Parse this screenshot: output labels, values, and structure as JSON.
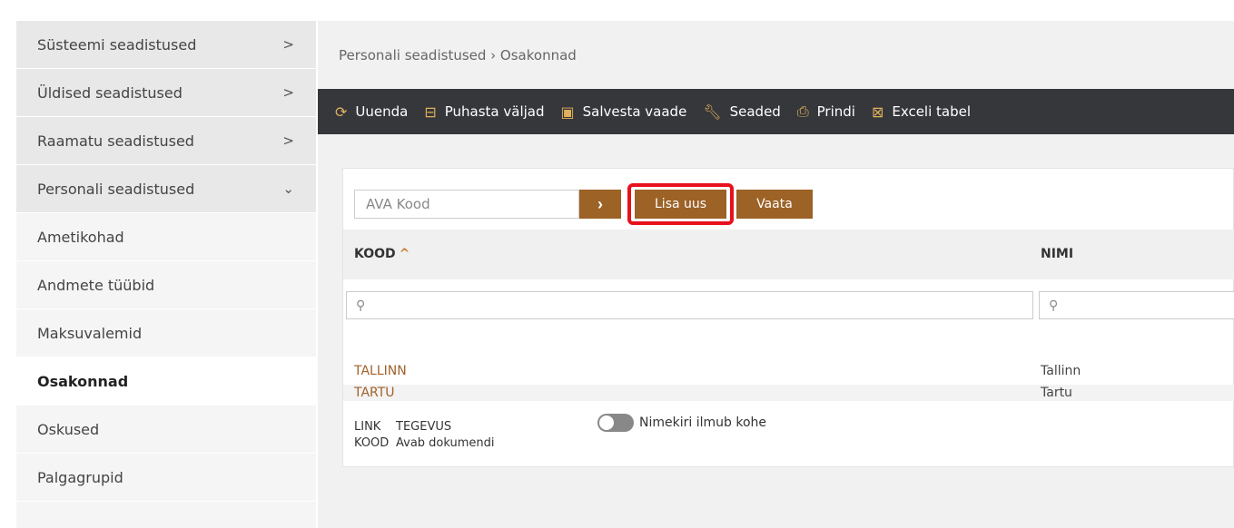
{
  "sidebar": {
    "items": [
      {
        "label": "Süsteemi seadistused",
        "chevron": ">"
      },
      {
        "label": "Üldised seadistused",
        "chevron": ">"
      },
      {
        "label": "Raamatu seadistused",
        "chevron": ">"
      },
      {
        "label": "Personali seadistused",
        "chevron": "⌄"
      },
      {
        "label": "Ametikohad"
      },
      {
        "label": "Andmete tüübid"
      },
      {
        "label": "Maksuvalemid"
      },
      {
        "label": "Osakonnad"
      },
      {
        "label": "Oskused"
      },
      {
        "label": "Palgagrupid"
      }
    ]
  },
  "breadcrumb": "Personali seadistused › Osakonnad",
  "toolbar": {
    "uuenda": "Uuenda",
    "puhasta": "Puhasta väljad",
    "salvesta": "Salvesta vaade",
    "seaded": "Seaded",
    "prindi": "Prindi",
    "excel": "Exceli tabel"
  },
  "search": {
    "placeholder": "AVA Kood",
    "go": "›"
  },
  "buttons": {
    "lisa_uus": "Lisa uus",
    "vaata": "Vaata"
  },
  "table": {
    "headers": {
      "kood": "KOOD",
      "nimi": "NIMI"
    },
    "rows": [
      {
        "kood": "TALLINN",
        "nimi": "Tallinn"
      },
      {
        "kood": "TARTU",
        "nimi": "Tartu"
      }
    ]
  },
  "footer": {
    "link": "LINK",
    "tegevus": "TEGEVUS",
    "kood": "KOOD",
    "avab": "Avab dokumendi",
    "toggle_label": "Nimekiri ilmub kohe"
  },
  "colors": {
    "accent": "#9c6226",
    "toolbar_bg": "#35373b",
    "highlight": "#e8101c"
  }
}
